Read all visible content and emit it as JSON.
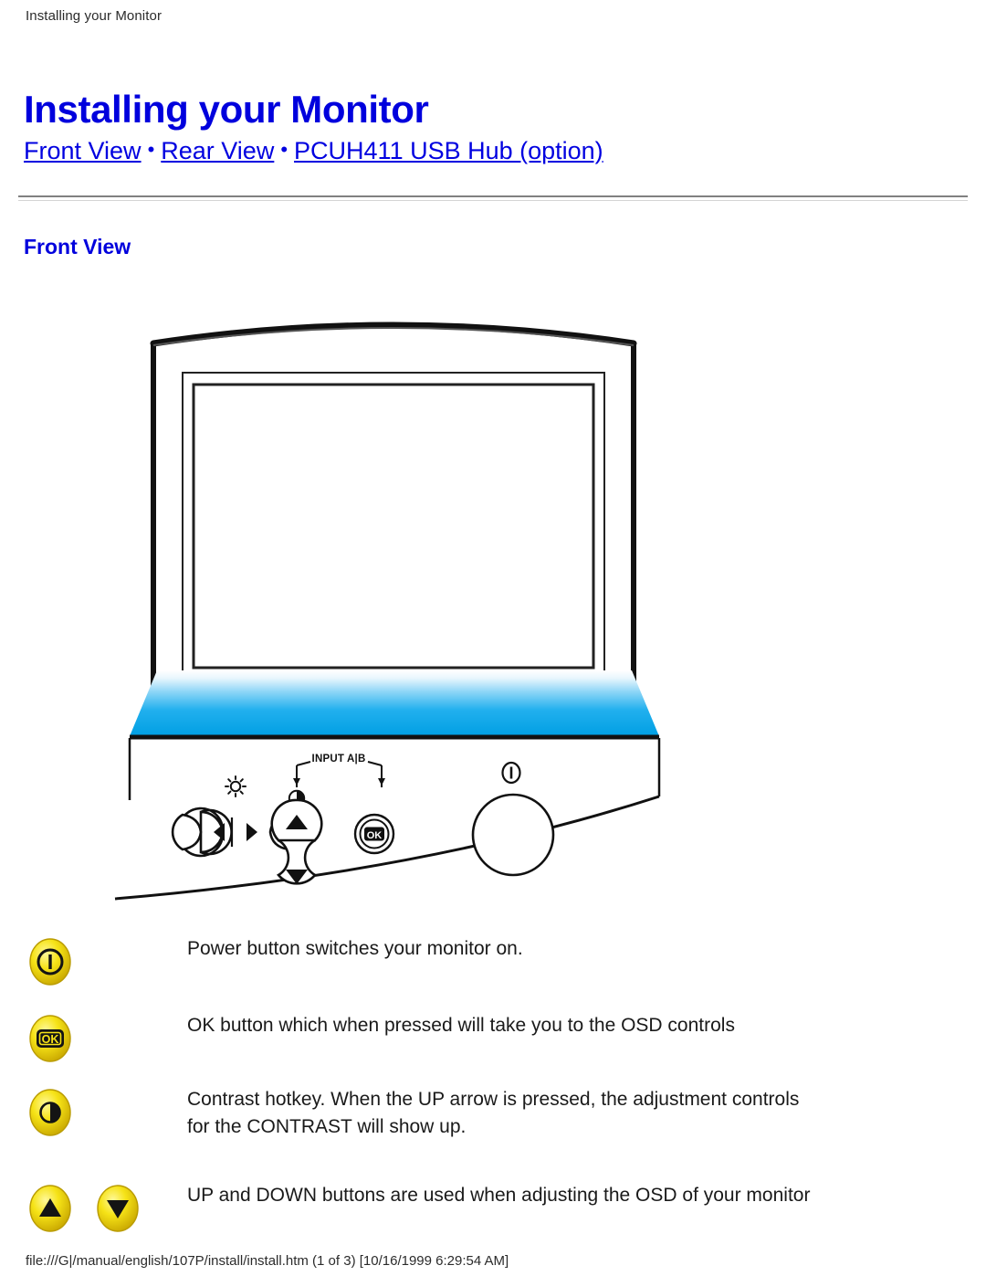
{
  "document": {
    "running_header": "Installing your Monitor",
    "title": "Installing your Monitor",
    "section_heading": "Front View",
    "footer_path": "file:///G|/manual/english/107P/install/install.htm (1 of 3) [10/16/1999 6:29:54 AM]"
  },
  "nav": {
    "separator": "•",
    "links": [
      {
        "label": "Front View"
      },
      {
        "label": "Rear View"
      },
      {
        "label": "PCUH411 USB Hub (option)"
      }
    ]
  },
  "illustration": {
    "alt": "Front view of CRT monitor showing bezel controls",
    "control_label": "INPUT A|B",
    "controls": [
      {
        "name": "brightness-rocker",
        "glyph": "sun"
      },
      {
        "name": "left-arrow-button",
        "glyph": "◀"
      },
      {
        "name": "right-arrow-button",
        "glyph": "▶"
      },
      {
        "name": "contrast-indicator",
        "glyph": "half-circle"
      },
      {
        "name": "up-arrow-button",
        "glyph": "▲"
      },
      {
        "name": "down-arrow-button",
        "glyph": "▼"
      },
      {
        "name": "ok-button",
        "glyph": "OK"
      },
      {
        "name": "power-indicator",
        "glyph": "power"
      },
      {
        "name": "power-button",
        "glyph": "circle"
      }
    ],
    "colors": {
      "bezel_outline": "#111111",
      "panel_gradient_top": "#ffffff",
      "panel_gradient_bottom": "#009fe3"
    }
  },
  "descriptions": [
    {
      "icons": [
        "power"
      ],
      "line1": "Power button switches your monitor on.",
      "line2": ""
    },
    {
      "icons": [
        "ok"
      ],
      "line1": "OK button which when pressed will take you to the OSD controls",
      "line2": ""
    },
    {
      "icons": [
        "contrast"
      ],
      "line1": "Contrast hotkey. When the UP arrow is pressed, the adjustment controls",
      "line2": "for the CONTRAST will show up."
    },
    {
      "icons": [
        "up",
        "down"
      ],
      "line1": "UP and DOWN buttons are used when adjusting the OSD of your monitor",
      "line2": ""
    }
  ],
  "colors": {
    "link": "#0000e0",
    "heading": "#0000dd",
    "button_yellow": "#f5e003",
    "button_yellow_dark": "#c9a800",
    "text": "#1a1a1a",
    "rule": "#808080"
  }
}
